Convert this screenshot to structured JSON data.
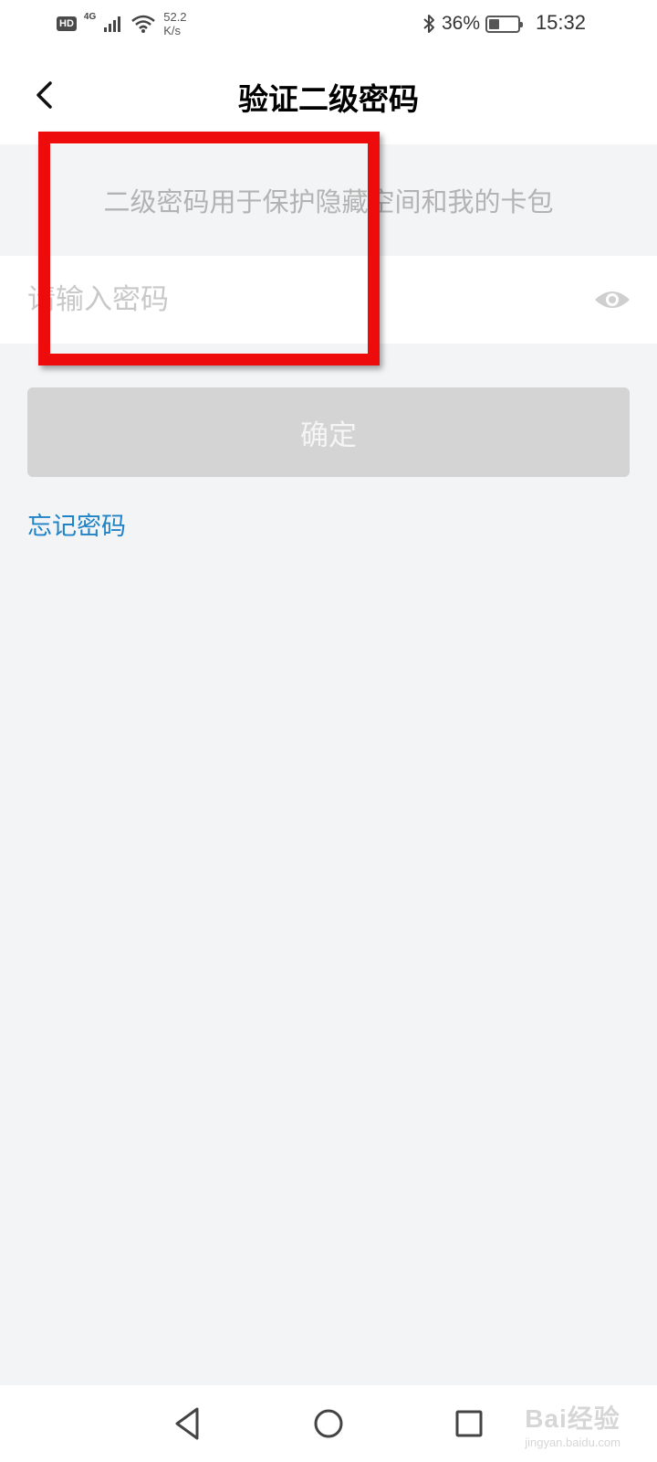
{
  "status_bar": {
    "hd": "HD",
    "network": "4G",
    "speed_value": "52.2",
    "speed_unit": "K/s",
    "battery": "36%",
    "battery_level": 0.36,
    "time": "15:32"
  },
  "header": {
    "title": "验证二级密码"
  },
  "notice": {
    "text": "二级密码用于保护隐藏空间和我的卡包"
  },
  "password_field": {
    "placeholder": "请输入密码",
    "value": ""
  },
  "confirm_button": {
    "label": "确定"
  },
  "forgot_link": {
    "label": "忘记密码"
  },
  "watermark": {
    "brand": "Bai经验",
    "url": "jingyan.baidu.com"
  },
  "colors": {
    "page_background": "#f3f4f6",
    "link_blue": "#1f83c6",
    "disabled_button": "#d4d4d4",
    "annotation_red": "#ee0b0b"
  },
  "icons": {
    "back": "chevron-left-icon",
    "visibility": "eye-icon",
    "nav_back": "triangle-back-icon",
    "nav_home": "circle-home-icon",
    "nav_recent": "square-recent-icon"
  }
}
